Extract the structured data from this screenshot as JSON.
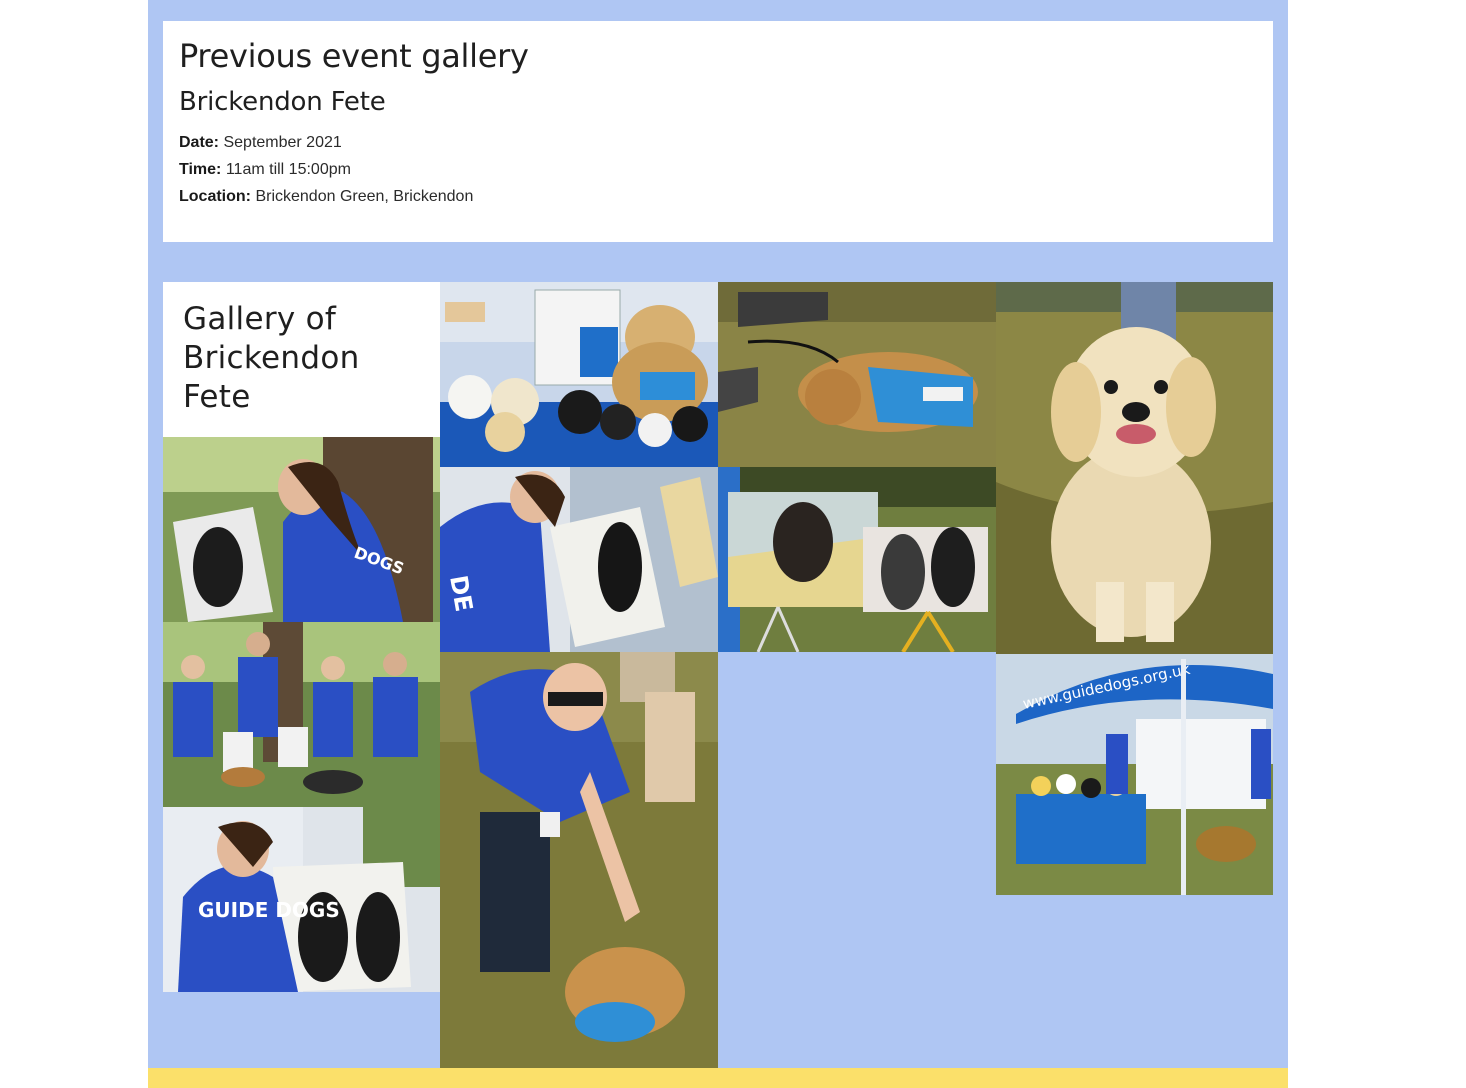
{
  "event": {
    "heading": "Previous event gallery",
    "name": "Brickendon Fete",
    "date_label": "Date:",
    "date_value": "September 2021",
    "time_label": "Time:",
    "time_value": "11am till 15:00pm",
    "location_label": "Location:",
    "location_value": "Brickendon Green, Brickendon"
  },
  "gallery": {
    "title": "Gallery of Brickendon Fete",
    "photos": [
      {
        "subject": "plush-toys-stall-photo"
      },
      {
        "subject": "puppy-lying-on-grass-photo"
      },
      {
        "subject": "golden-puppy-sitting-photo"
      },
      {
        "subject": "volunteer-painting-dog-photo"
      },
      {
        "subject": "volunteer-painting-canvas-photo"
      },
      {
        "subject": "dog-paintings-on-easels-photo"
      },
      {
        "subject": "volunteers-with-dogs-photo"
      },
      {
        "subject": "volunteer-petting-dog-photo"
      },
      {
        "subject": "guide-dogs-gazebo-stall-photo"
      },
      {
        "subject": "volunteer-painting-closeup-photo"
      }
    ],
    "gazebo_text": "www.guidedogs.org.uk",
    "shirt_text": "GUIDE DOGS"
  },
  "colors": {
    "page_background": "#afc6f3",
    "footer_strip": "#fbe06a",
    "shirt_blue": "#2a4fc4",
    "grass": "#7d7a3a"
  }
}
